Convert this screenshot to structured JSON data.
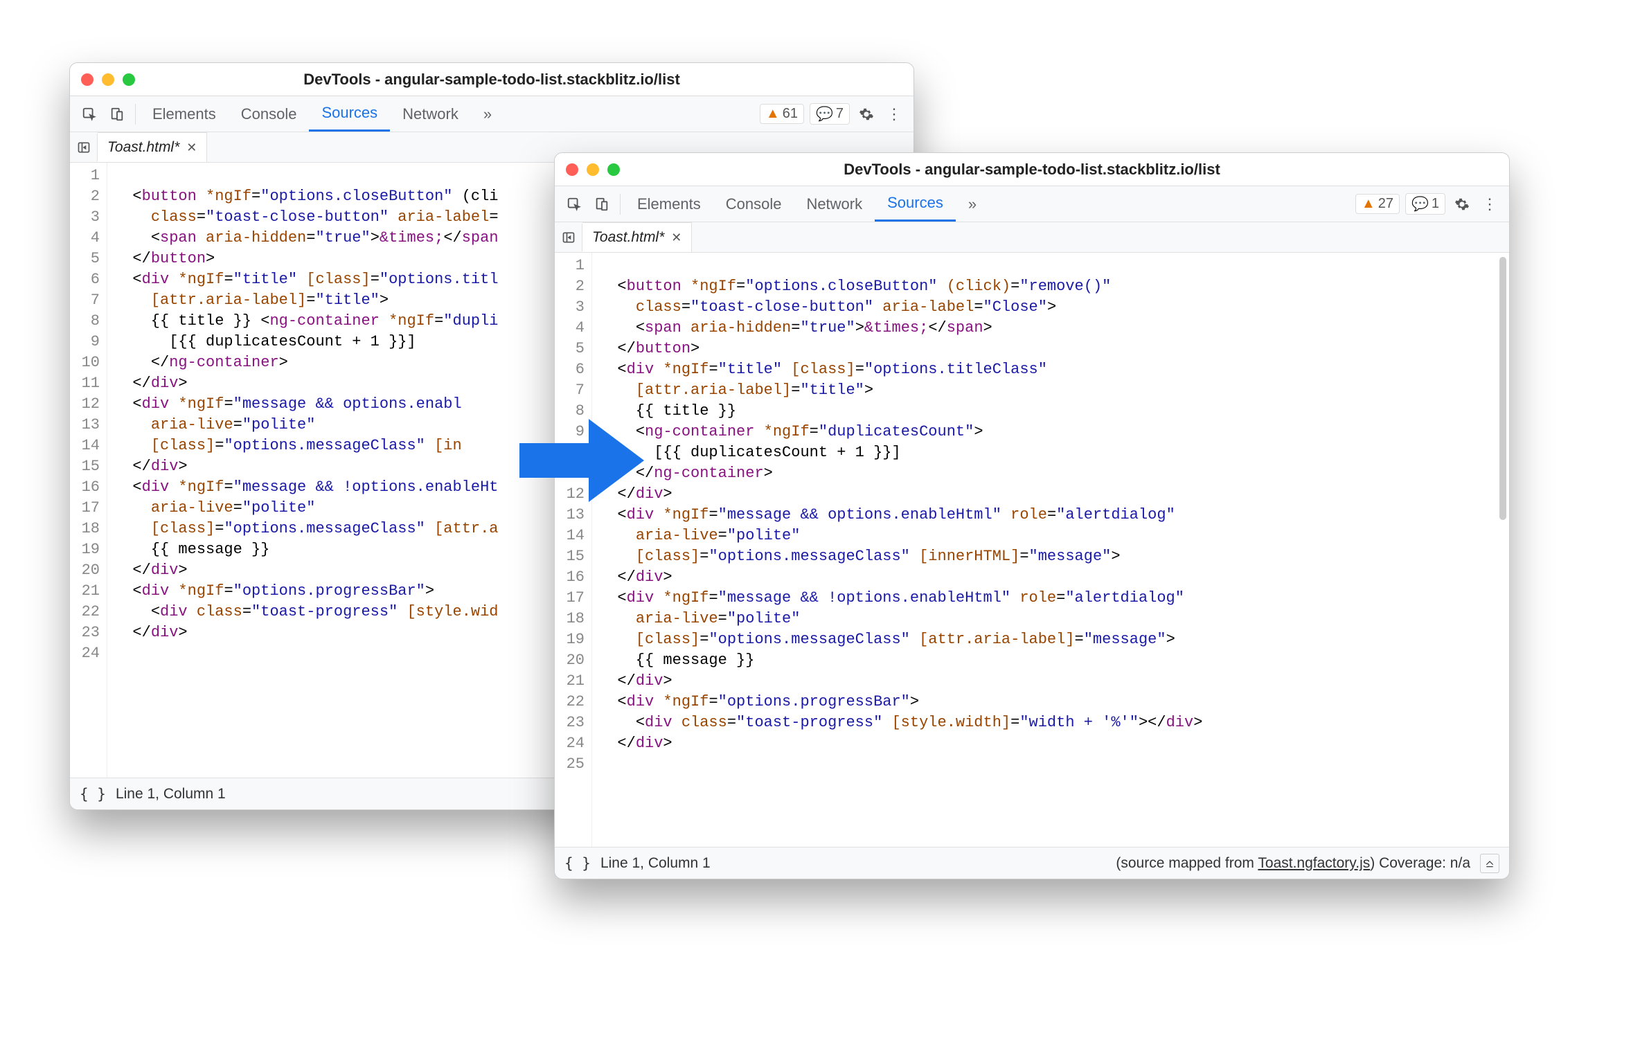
{
  "windows": {
    "back": {
      "title": "DevTools - angular-sample-todo-list.stackblitz.io/list",
      "tabs": [
        "Elements",
        "Console",
        "Sources",
        "Network"
      ],
      "active_tab": "Sources",
      "more_glyph": "»",
      "warnings": "61",
      "messages": "7",
      "file_tab": "Toast.html*",
      "line_count": 24,
      "status_left": "Line 1, Column 1",
      "status_right_prefix": "(source mapped from "
    },
    "front": {
      "title": "DevTools - angular-sample-todo-list.stackblitz.io/list",
      "tabs": [
        "Elements",
        "Console",
        "Network",
        "Sources"
      ],
      "active_tab": "Sources",
      "more_glyph": "»",
      "warnings": "27",
      "messages": "1",
      "file_tab": "Toast.html*",
      "line_count": 25,
      "status_left": "Line 1, Column 1",
      "status_right_prefix": "(source mapped from ",
      "status_right_link": "Toast.ngfactory.js",
      "status_right_suffix": ") Coverage: n/a"
    }
  },
  "code": {
    "tokens_24": [
      [],
      [
        [
          "  ",
          "pun"
        ],
        [
          "<",
          "pun"
        ],
        [
          "button",
          "tag"
        ],
        [
          " ",
          "pun"
        ],
        [
          "*ngIf",
          "attr"
        ],
        [
          "=",
          "pun"
        ],
        [
          "\"options.closeButton\"",
          "str"
        ],
        [
          " (cli",
          "pun"
        ]
      ],
      [
        [
          "    ",
          "pun"
        ],
        [
          "class",
          "attr"
        ],
        [
          "=",
          "pun"
        ],
        [
          "\"toast-close-button\"",
          "str"
        ],
        [
          " ",
          "pun"
        ],
        [
          "aria-label",
          "attr"
        ],
        [
          "=",
          "pun"
        ]
      ],
      [
        [
          "    ",
          "pun"
        ],
        [
          "<",
          "pun"
        ],
        [
          "span",
          "tag"
        ],
        [
          " ",
          "pun"
        ],
        [
          "aria-hidden",
          "attr"
        ],
        [
          "=",
          "pun"
        ],
        [
          "\"true\"",
          "str"
        ],
        [
          ">",
          "pun"
        ],
        [
          "&times;",
          "amp"
        ],
        [
          "</",
          "pun"
        ],
        [
          "span",
          "tag"
        ]
      ],
      [
        [
          "  ",
          "pun"
        ],
        [
          "</",
          "pun"
        ],
        [
          "button",
          "tag"
        ],
        [
          ">",
          "pun"
        ]
      ],
      [
        [
          "  ",
          "pun"
        ],
        [
          "<",
          "pun"
        ],
        [
          "div",
          "tag"
        ],
        [
          " ",
          "pun"
        ],
        [
          "*ngIf",
          "attr"
        ],
        [
          "=",
          "pun"
        ],
        [
          "\"title\"",
          "str"
        ],
        [
          " ",
          "pun"
        ],
        [
          "[class]",
          "attr"
        ],
        [
          "=",
          "pun"
        ],
        [
          "\"options.titl",
          "str"
        ]
      ],
      [
        [
          "    ",
          "pun"
        ],
        [
          "[attr.aria-label]",
          "attr"
        ],
        [
          "=",
          "pun"
        ],
        [
          "\"title\"",
          "str"
        ],
        [
          ">",
          "pun"
        ]
      ],
      [
        [
          "    {{ title }} ",
          "expr"
        ],
        [
          "<",
          "pun"
        ],
        [
          "ng-container",
          "tag"
        ],
        [
          " ",
          "pun"
        ],
        [
          "*ngIf",
          "attr"
        ],
        [
          "=",
          "pun"
        ],
        [
          "\"dupli",
          "str"
        ]
      ],
      [
        [
          "      [{{ duplicatesCount + 1 }}]",
          "expr"
        ]
      ],
      [
        [
          "    ",
          "pun"
        ],
        [
          "</",
          "pun"
        ],
        [
          "ng-container",
          "tag"
        ],
        [
          ">",
          "pun"
        ]
      ],
      [
        [
          "  ",
          "pun"
        ],
        [
          "</",
          "pun"
        ],
        [
          "div",
          "tag"
        ],
        [
          ">",
          "pun"
        ]
      ],
      [
        [
          "  ",
          "pun"
        ],
        [
          "<",
          "pun"
        ],
        [
          "div",
          "tag"
        ],
        [
          " ",
          "pun"
        ],
        [
          "*ngIf",
          "attr"
        ],
        [
          "=",
          "pun"
        ],
        [
          "\"message && options.enabl",
          "str"
        ]
      ],
      [
        [
          "    ",
          "pun"
        ],
        [
          "aria-live",
          "attr"
        ],
        [
          "=",
          "pun"
        ],
        [
          "\"polite\"",
          "str"
        ]
      ],
      [
        [
          "    ",
          "pun"
        ],
        [
          "[class]",
          "attr"
        ],
        [
          "=",
          "pun"
        ],
        [
          "\"options.messageClass\"",
          "str"
        ],
        [
          " ",
          "pun"
        ],
        [
          "[in",
          "attr"
        ]
      ],
      [
        [
          "  ",
          "pun"
        ],
        [
          "</",
          "pun"
        ],
        [
          "div",
          "tag"
        ],
        [
          ">",
          "pun"
        ]
      ],
      [
        [
          "  ",
          "pun"
        ],
        [
          "<",
          "pun"
        ],
        [
          "div",
          "tag"
        ],
        [
          " ",
          "pun"
        ],
        [
          "*ngIf",
          "attr"
        ],
        [
          "=",
          "pun"
        ],
        [
          "\"message && !options.enableHt",
          "str"
        ]
      ],
      [
        [
          "    ",
          "pun"
        ],
        [
          "aria-live",
          "attr"
        ],
        [
          "=",
          "pun"
        ],
        [
          "\"polite\"",
          "str"
        ]
      ],
      [
        [
          "    ",
          "pun"
        ],
        [
          "[class]",
          "attr"
        ],
        [
          "=",
          "pun"
        ],
        [
          "\"options.messageClass\"",
          "str"
        ],
        [
          " ",
          "pun"
        ],
        [
          "[attr.a",
          "attr"
        ]
      ],
      [
        [
          "    {{ message }}",
          "expr"
        ]
      ],
      [
        [
          "  ",
          "pun"
        ],
        [
          "</",
          "pun"
        ],
        [
          "div",
          "tag"
        ],
        [
          ">",
          "pun"
        ]
      ],
      [
        [
          "  ",
          "pun"
        ],
        [
          "<",
          "pun"
        ],
        [
          "div",
          "tag"
        ],
        [
          " ",
          "pun"
        ],
        [
          "*ngIf",
          "attr"
        ],
        [
          "=",
          "pun"
        ],
        [
          "\"options.progressBar\"",
          "str"
        ],
        [
          ">",
          "pun"
        ]
      ],
      [
        [
          "    ",
          "pun"
        ],
        [
          "<",
          "pun"
        ],
        [
          "div",
          "tag"
        ],
        [
          " ",
          "pun"
        ],
        [
          "class",
          "attr"
        ],
        [
          "=",
          "pun"
        ],
        [
          "\"toast-progress\"",
          "str"
        ],
        [
          " ",
          "pun"
        ],
        [
          "[style.wid",
          "attr"
        ]
      ],
      [
        [
          "  ",
          "pun"
        ],
        [
          "</",
          "pun"
        ],
        [
          "div",
          "tag"
        ],
        [
          ">",
          "pun"
        ]
      ],
      []
    ],
    "tokens_25": [
      [],
      [
        [
          "  ",
          "pun"
        ],
        [
          "<",
          "pun"
        ],
        [
          "button",
          "tag"
        ],
        [
          " ",
          "pun"
        ],
        [
          "*ngIf",
          "attr"
        ],
        [
          "=",
          "pun"
        ],
        [
          "\"options.closeButton\"",
          "str"
        ],
        [
          " ",
          "pun"
        ],
        [
          "(click)",
          "attr"
        ],
        [
          "=",
          "pun"
        ],
        [
          "\"remove()\"",
          "str"
        ]
      ],
      [
        [
          "    ",
          "pun"
        ],
        [
          "class",
          "attr"
        ],
        [
          "=",
          "pun"
        ],
        [
          "\"toast-close-button\"",
          "str"
        ],
        [
          " ",
          "pun"
        ],
        [
          "aria-label",
          "attr"
        ],
        [
          "=",
          "pun"
        ],
        [
          "\"Close\"",
          "str"
        ],
        [
          ">",
          "pun"
        ]
      ],
      [
        [
          "    ",
          "pun"
        ],
        [
          "<",
          "pun"
        ],
        [
          "span",
          "tag"
        ],
        [
          " ",
          "pun"
        ],
        [
          "aria-hidden",
          "attr"
        ],
        [
          "=",
          "pun"
        ],
        [
          "\"true\"",
          "str"
        ],
        [
          ">",
          "pun"
        ],
        [
          "&times;",
          "amp"
        ],
        [
          "</",
          "pun"
        ],
        [
          "span",
          "tag"
        ],
        [
          ">",
          "pun"
        ]
      ],
      [
        [
          "  ",
          "pun"
        ],
        [
          "</",
          "pun"
        ],
        [
          "button",
          "tag"
        ],
        [
          ">",
          "pun"
        ]
      ],
      [
        [
          "  ",
          "pun"
        ],
        [
          "<",
          "pun"
        ],
        [
          "div",
          "tag"
        ],
        [
          " ",
          "pun"
        ],
        [
          "*ngIf",
          "attr"
        ],
        [
          "=",
          "pun"
        ],
        [
          "\"title\"",
          "str"
        ],
        [
          " ",
          "pun"
        ],
        [
          "[class]",
          "attr"
        ],
        [
          "=",
          "pun"
        ],
        [
          "\"options.titleClass\"",
          "str"
        ]
      ],
      [
        [
          "    ",
          "pun"
        ],
        [
          "[attr.aria-label]",
          "attr"
        ],
        [
          "=",
          "pun"
        ],
        [
          "\"title\"",
          "str"
        ],
        [
          ">",
          "pun"
        ]
      ],
      [
        [
          "    {{ title }}",
          "expr"
        ]
      ],
      [
        [
          "    ",
          "pun"
        ],
        [
          "<",
          "pun"
        ],
        [
          "ng-container",
          "tag"
        ],
        [
          " ",
          "pun"
        ],
        [
          "*ngIf",
          "attr"
        ],
        [
          "=",
          "pun"
        ],
        [
          "\"duplicatesCount\"",
          "str"
        ],
        [
          ">",
          "pun"
        ]
      ],
      [
        [
          "      [{{ duplicatesCount + 1 }}]",
          "expr"
        ]
      ],
      [
        [
          "    ",
          "pun"
        ],
        [
          "</",
          "pun"
        ],
        [
          "ng-container",
          "tag"
        ],
        [
          ">",
          "pun"
        ]
      ],
      [
        [
          "  ",
          "pun"
        ],
        [
          "</",
          "pun"
        ],
        [
          "div",
          "tag"
        ],
        [
          ">",
          "pun"
        ]
      ],
      [
        [
          "  ",
          "pun"
        ],
        [
          "<",
          "pun"
        ],
        [
          "div",
          "tag"
        ],
        [
          " ",
          "pun"
        ],
        [
          "*ngIf",
          "attr"
        ],
        [
          "=",
          "pun"
        ],
        [
          "\"message && options.enableHtml\"",
          "str"
        ],
        [
          " ",
          "pun"
        ],
        [
          "role",
          "attr"
        ],
        [
          "=",
          "pun"
        ],
        [
          "\"alertdialog\"",
          "str"
        ]
      ],
      [
        [
          "    ",
          "pun"
        ],
        [
          "aria-live",
          "attr"
        ],
        [
          "=",
          "pun"
        ],
        [
          "\"polite\"",
          "str"
        ]
      ],
      [
        [
          "    ",
          "pun"
        ],
        [
          "[class]",
          "attr"
        ],
        [
          "=",
          "pun"
        ],
        [
          "\"options.messageClass\"",
          "str"
        ],
        [
          " ",
          "pun"
        ],
        [
          "[innerHTML]",
          "attr"
        ],
        [
          "=",
          "pun"
        ],
        [
          "\"message\"",
          "str"
        ],
        [
          ">",
          "pun"
        ]
      ],
      [
        [
          "  ",
          "pun"
        ],
        [
          "</",
          "pun"
        ],
        [
          "div",
          "tag"
        ],
        [
          ">",
          "pun"
        ]
      ],
      [
        [
          "  ",
          "pun"
        ],
        [
          "<",
          "pun"
        ],
        [
          "div",
          "tag"
        ],
        [
          " ",
          "pun"
        ],
        [
          "*ngIf",
          "attr"
        ],
        [
          "=",
          "pun"
        ],
        [
          "\"message && !options.enableHtml\"",
          "str"
        ],
        [
          " ",
          "pun"
        ],
        [
          "role",
          "attr"
        ],
        [
          "=",
          "pun"
        ],
        [
          "\"alertdialog\"",
          "str"
        ]
      ],
      [
        [
          "    ",
          "pun"
        ],
        [
          "aria-live",
          "attr"
        ],
        [
          "=",
          "pun"
        ],
        [
          "\"polite\"",
          "str"
        ]
      ],
      [
        [
          "    ",
          "pun"
        ],
        [
          "[class]",
          "attr"
        ],
        [
          "=",
          "pun"
        ],
        [
          "\"options.messageClass\"",
          "str"
        ],
        [
          " ",
          "pun"
        ],
        [
          "[attr.aria-label]",
          "attr"
        ],
        [
          "=",
          "pun"
        ],
        [
          "\"message\"",
          "str"
        ],
        [
          ">",
          "pun"
        ]
      ],
      [
        [
          "    {{ message }}",
          "expr"
        ]
      ],
      [
        [
          "  ",
          "pun"
        ],
        [
          "</",
          "pun"
        ],
        [
          "div",
          "tag"
        ],
        [
          ">",
          "pun"
        ]
      ],
      [
        [
          "  ",
          "pun"
        ],
        [
          "<",
          "pun"
        ],
        [
          "div",
          "tag"
        ],
        [
          " ",
          "pun"
        ],
        [
          "*ngIf",
          "attr"
        ],
        [
          "=",
          "pun"
        ],
        [
          "\"options.progressBar\"",
          "str"
        ],
        [
          ">",
          "pun"
        ]
      ],
      [
        [
          "    ",
          "pun"
        ],
        [
          "<",
          "pun"
        ],
        [
          "div",
          "tag"
        ],
        [
          " ",
          "pun"
        ],
        [
          "class",
          "attr"
        ],
        [
          "=",
          "pun"
        ],
        [
          "\"toast-progress\"",
          "str"
        ],
        [
          " ",
          "pun"
        ],
        [
          "[style.width]",
          "attr"
        ],
        [
          "=",
          "pun"
        ],
        [
          "\"width + '%'\"",
          "str"
        ],
        [
          "></",
          "pun"
        ],
        [
          "div",
          "tag"
        ],
        [
          ">",
          "pun"
        ]
      ],
      [
        [
          "  ",
          "pun"
        ],
        [
          "</",
          "pun"
        ],
        [
          "div",
          "tag"
        ],
        [
          ">",
          "pun"
        ]
      ],
      []
    ]
  }
}
